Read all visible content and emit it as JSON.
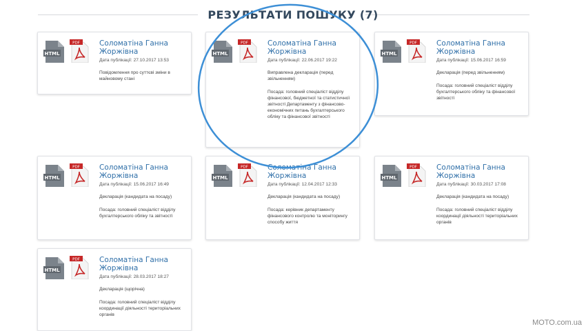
{
  "title": "РЕЗУЛЬТАТИ ПОШУКУ (7)",
  "colors": {
    "accent": "#2f6fa8",
    "pdf_red": "#c62828",
    "html_gray": "#6f7780",
    "annotation_ring": "#3d8fd6"
  },
  "cards": [
    {
      "name": "Соломатіна Ганна Жоржівна",
      "date": "Дата публікації: 27.10.2017 13:53",
      "doc_type": "Повідомлення про суттєві зміни в майновому стані",
      "position": ""
    },
    {
      "name": "Соломатіна Ганна Жоржівна",
      "date": "Дата публікації: 22.06.2017 19:22",
      "doc_type": "Виправлена декларація (перед звільненням)",
      "position": "Посада: головний спеціаліст відділу фінансової, бюджетної та статистичної звітності Департаменту з фінансово-економічних питань бухгалтерського обліку та фінансової звітності"
    },
    {
      "name": "Соломатіна Ганна Жоржівна",
      "date": "Дата публікації: 15.06.2017 16:59",
      "doc_type": "Декларація (перед звільненням)",
      "position": "Посада: головний спеціаліст відділу бухгалтерського обліку та фінансової звітності"
    },
    {
      "name": "Соломатіна Ганна Жоржівна",
      "date": "Дата публікації: 15.06.2017 16:49",
      "doc_type": "Декларація (кандидата на посаду)",
      "position": "Посада: головний спеціаліст відділу бухгалтерського обліку та звітності"
    },
    {
      "name": "Соломатіна Ганна Жоржівна",
      "date": "Дата публікації: 12.04.2017 12:33",
      "doc_type": "Декларація (кандидата на посаду)",
      "position": "Посада: керівник департаменту фінансового контролю та моніторингу способу життя"
    },
    {
      "name": "Соломатіна Ганна Жоржівна",
      "date": "Дата публікації: 30.03.2017 17:08",
      "doc_type": "Декларація (кандидата на посаду)",
      "position": "Посада: головний спеціаліст відділу координації діяльності територіальних органів"
    },
    {
      "name": "Соломатіна Ганна Жоржівна",
      "date": "Дата публікації: 28.03.2017 18:27",
      "doc_type": "Декларація (щорічна)",
      "position": "Посада: головний спеціаліст відділу координації діяльності територіальних органів"
    }
  ],
  "icons": {
    "html_label": "HTML",
    "pdf_label": "PDF"
  },
  "watermark": "MOTO.com.ua"
}
